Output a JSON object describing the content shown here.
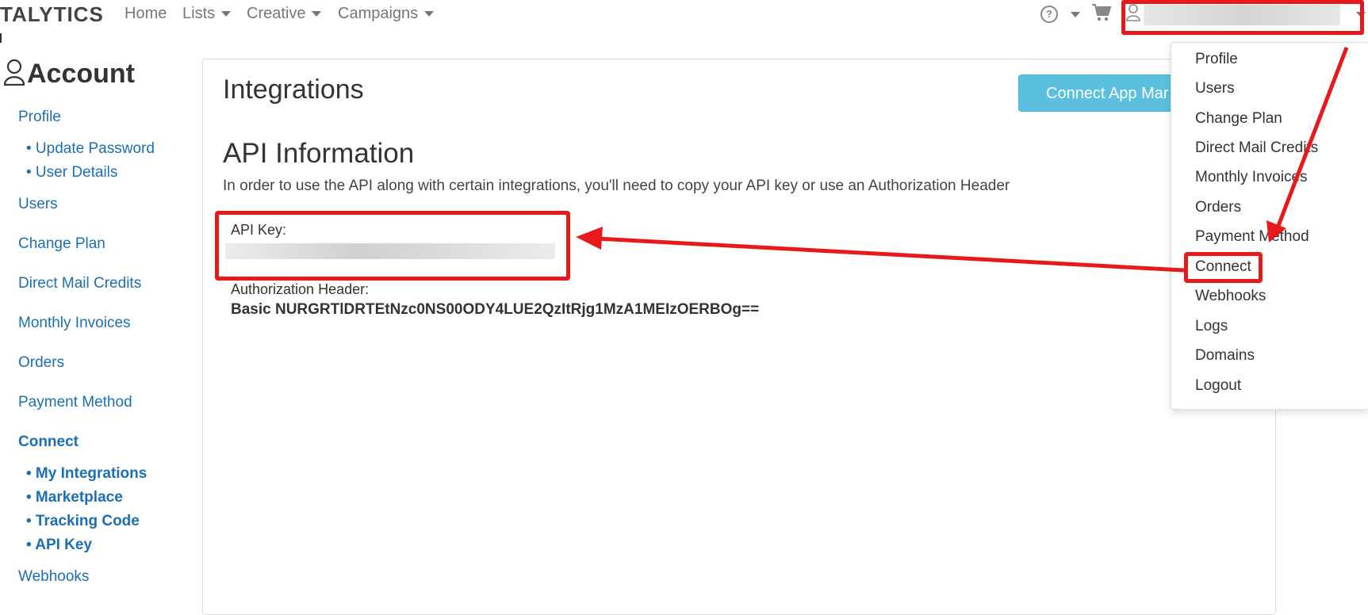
{
  "navbar": {
    "brand": "TALYTICS",
    "items": [
      {
        "label": "Home",
        "has_caret": false
      },
      {
        "label": "Lists",
        "has_caret": true
      },
      {
        "label": "Creative",
        "has_caret": true
      },
      {
        "label": "Campaigns",
        "has_caret": true
      }
    ],
    "help_icon": "?",
    "cart_icon": "cart-icon",
    "user_icon": "user-icon"
  },
  "sidebar": {
    "title": "Account",
    "items": [
      {
        "label": "Profile"
      },
      {
        "label": "• Update Password"
      },
      {
        "label": "• User Details"
      },
      {
        "label": "Users"
      },
      {
        "label": "Change Plan"
      },
      {
        "label": "Direct Mail Credits"
      },
      {
        "label": "Monthly Invoices"
      },
      {
        "label": "Orders"
      },
      {
        "label": "Payment Method"
      },
      {
        "label": "Connect"
      },
      {
        "label": "• My Integrations"
      },
      {
        "label": "• Marketplace"
      },
      {
        "label": "• Tracking Code"
      },
      {
        "label": "• API Key"
      },
      {
        "label": "Webhooks"
      }
    ]
  },
  "main": {
    "title": "Integrations",
    "connect_button": "Connect App Mar",
    "api_title": "API Information",
    "api_description": "In order to use the API along with certain integrations, you'll need to copy your API key or use an Authorization Header",
    "api_key_label": "API Key:",
    "auth_header_label": "Authorization Header:",
    "auth_header_value": "Basic NURGRTlDRTEtNzc0NS00ODY4LUE2QzItRjg1MzA1MEIzOERBOg=="
  },
  "dropdown": {
    "items": [
      {
        "label": "Profile"
      },
      {
        "label": "Users"
      },
      {
        "label": "Change Plan"
      },
      {
        "label": "Direct Mail Credits"
      },
      {
        "label": "Monthly Invoices"
      },
      {
        "label": "Orders"
      },
      {
        "label": "Payment Method"
      },
      {
        "label": "Connect"
      },
      {
        "label": "Webhooks"
      },
      {
        "label": "Logs"
      },
      {
        "label": "Domains"
      },
      {
        "label": "Logout"
      }
    ]
  },
  "colors": {
    "link": "#1a6fb5",
    "annotation_red": "#e8191a",
    "info_button": "#5bc0de"
  }
}
